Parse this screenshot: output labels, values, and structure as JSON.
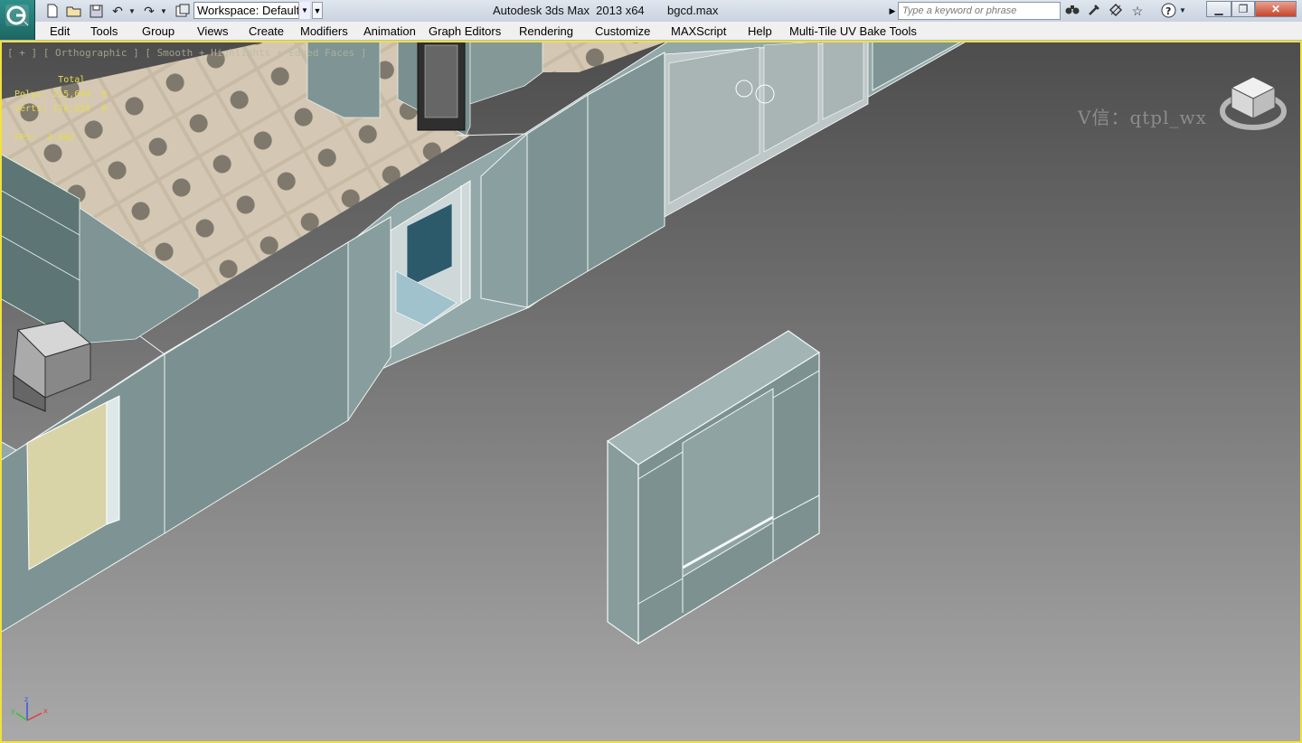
{
  "titlebar": {
    "workspace_label": "Workspace: Default",
    "app_title": "Autodesk 3ds Max  2013 x64",
    "file_title": "bgcd.max",
    "search_placeholder": "Type a keyword or phrase",
    "icons": [
      "new-file-icon",
      "open-folder-icon",
      "save-icon",
      "undo-icon",
      "redo-icon",
      "project-folder-icon",
      "binoculars-icon",
      "subscription-icon",
      "communication-icon",
      "favorites-star-icon",
      "help-icon",
      "minimize-icon",
      "restore-icon",
      "close-icon"
    ]
  },
  "menubar": {
    "items": [
      "Edit",
      "Tools",
      "Group",
      "Views",
      "Create",
      "Modifiers",
      "Animation",
      "Graph Editors",
      "Rendering",
      "Customize",
      "MAXScript",
      "Help",
      "Multi-Tile UV Bake Tools"
    ]
  },
  "viewport": {
    "label": "[ + ] [ Orthographic ] [ Smooth + Highlights + Edged Faces ]",
    "stats": {
      "title": "Total",
      "polys_label": "Polys:",
      "polys_value": "215,644",
      "polys_sel": "0",
      "verts_label": "Verts:",
      "verts_value": "170,659",
      "verts_sel": "0",
      "fps_label": "FPS:",
      "fps_value": "3.002"
    },
    "watermark": "V信：qtpl_wx",
    "axis": {
      "x": "x",
      "y": "y",
      "z": "z"
    },
    "colors": {
      "active_border": "#f1e13c",
      "stats_text": "#e6dc4a",
      "wall": "#7f9494"
    }
  }
}
